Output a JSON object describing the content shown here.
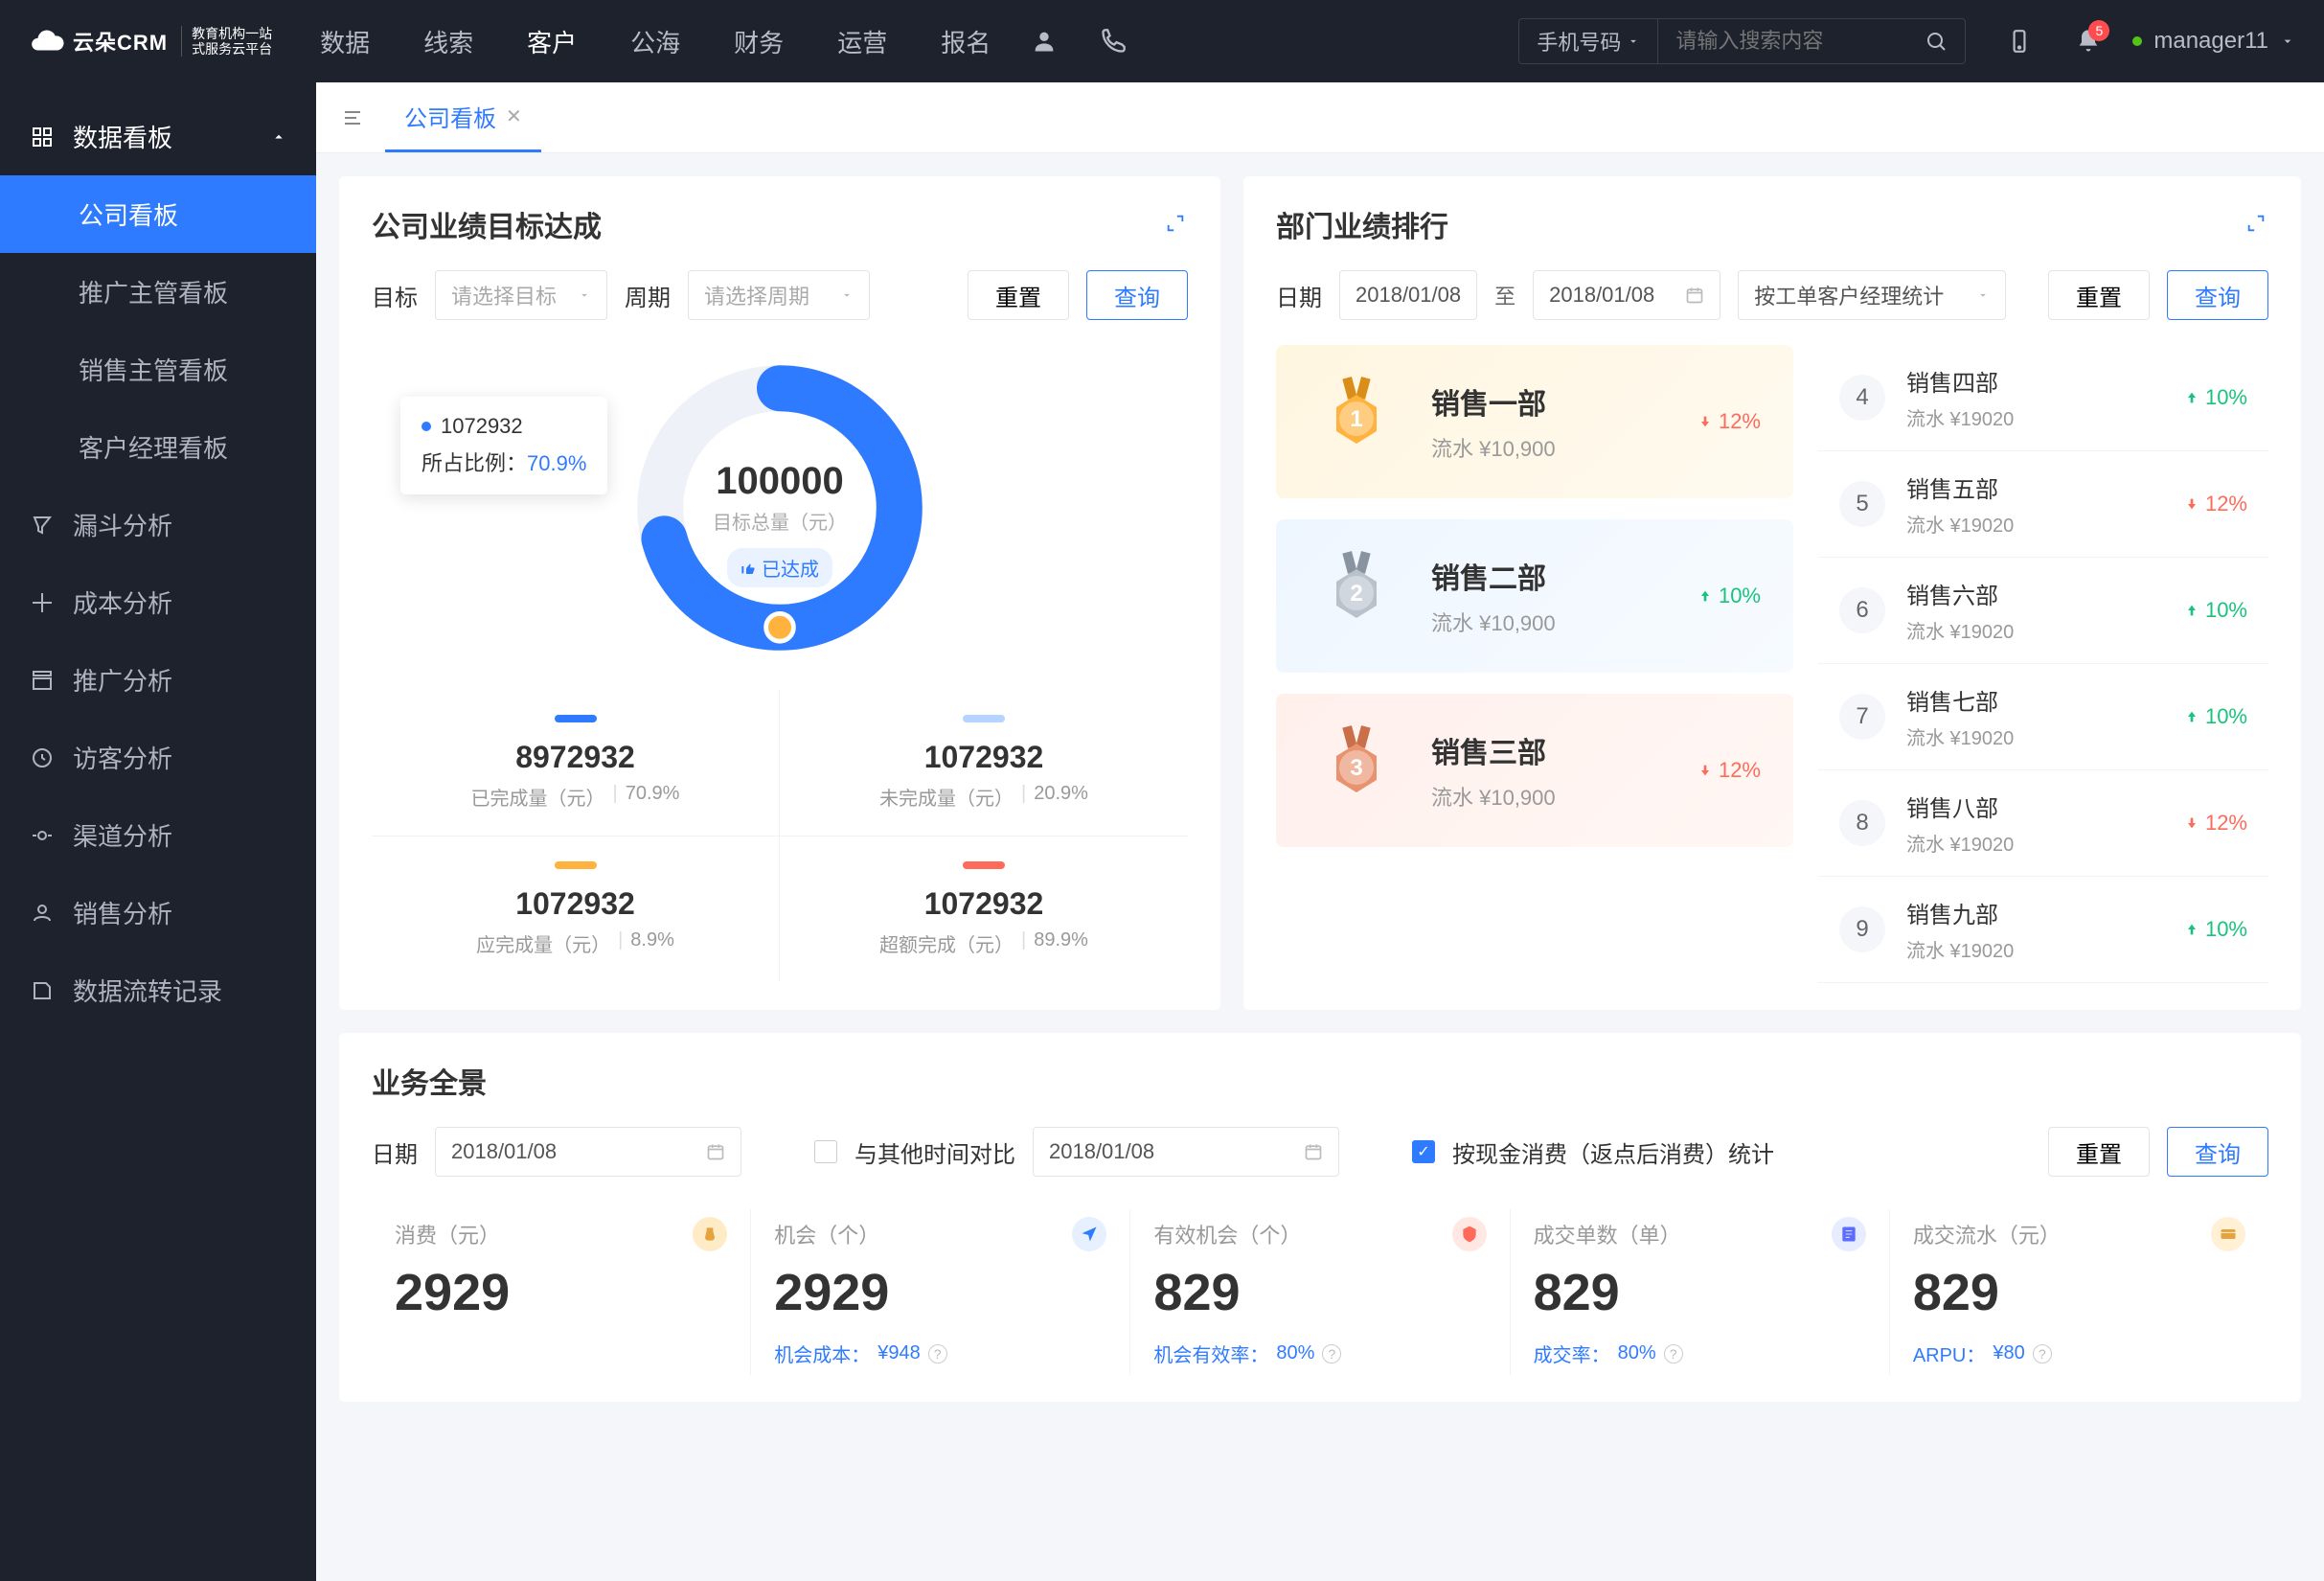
{
  "brand": {
    "name": "云朵CRM",
    "sub1": "教育机构一站",
    "sub2": "式服务云平台"
  },
  "topnav": {
    "items": [
      "数据",
      "线索",
      "客户",
      "公海",
      "财务",
      "运营",
      "报名"
    ],
    "active": 2
  },
  "search": {
    "type": "手机号码",
    "placeholder": "请输入搜索内容"
  },
  "notif_count": "5",
  "user": "manager11",
  "sidebar": {
    "group": "数据看板",
    "subs": [
      "公司看板",
      "推广主管看板",
      "销售主管看板",
      "客户经理看板"
    ],
    "active_sub": 0,
    "items": [
      "漏斗分析",
      "成本分析",
      "推广分析",
      "访客分析",
      "渠道分析",
      "销售分析",
      "数据流转记录"
    ]
  },
  "tab": {
    "label": "公司看板"
  },
  "goals": {
    "title": "公司业绩目标达成",
    "filters": {
      "target_label": "目标",
      "target_ph": "请选择目标",
      "period_label": "周期",
      "period_ph": "请选择周期",
      "reset": "重置",
      "query": "查询"
    },
    "donut": {
      "total": "100000",
      "total_label": "目标总量（元）",
      "badge": "已达成"
    },
    "tooltip": {
      "value": "1072932",
      "ratio_label": "所占比例：",
      "ratio": "70.9%"
    },
    "metrics": [
      {
        "color": "#2f7bff",
        "val": "8972932",
        "label": "已完成量（元）",
        "pct": "70.9%"
      },
      {
        "color": "#b5d4ff",
        "val": "1072932",
        "label": "未完成量（元）",
        "pct": "20.9%"
      },
      {
        "color": "#ffb23e",
        "val": "1072932",
        "label": "应完成量（元）",
        "pct": "8.9%"
      },
      {
        "color": "#ff6a5b",
        "val": "1072932",
        "label": "超额完成（元）",
        "pct": "89.9%"
      }
    ]
  },
  "ranking": {
    "title": "部门业绩排行",
    "filters": {
      "date_label": "日期",
      "date_from": "2018/01/08",
      "sep": "至",
      "date_to": "2018/01/08",
      "stat_by": "按工单客户经理统计",
      "reset": "重置",
      "query": "查询"
    },
    "top": [
      {
        "rank": "1",
        "name": "销售一部",
        "sub": "流水 ¥10,900",
        "trend": "down",
        "pct": "12%"
      },
      {
        "rank": "2",
        "name": "销售二部",
        "sub": "流水 ¥10,900",
        "trend": "up",
        "pct": "10%"
      },
      {
        "rank": "3",
        "name": "销售三部",
        "sub": "流水 ¥10,900",
        "trend": "down",
        "pct": "12%"
      }
    ],
    "rest": [
      {
        "rank": "4",
        "name": "销售四部",
        "sub": "流水 ¥19020",
        "trend": "up",
        "pct": "10%"
      },
      {
        "rank": "5",
        "name": "销售五部",
        "sub": "流水 ¥19020",
        "trend": "down",
        "pct": "12%"
      },
      {
        "rank": "6",
        "name": "销售六部",
        "sub": "流水 ¥19020",
        "trend": "up",
        "pct": "10%"
      },
      {
        "rank": "7",
        "name": "销售七部",
        "sub": "流水 ¥19020",
        "trend": "up",
        "pct": "10%"
      },
      {
        "rank": "8",
        "name": "销售八部",
        "sub": "流水 ¥19020",
        "trend": "down",
        "pct": "12%"
      },
      {
        "rank": "9",
        "name": "销售九部",
        "sub": "流水 ¥19020",
        "trend": "up",
        "pct": "10%"
      }
    ]
  },
  "overview": {
    "title": "业务全景",
    "filters": {
      "date_label": "日期",
      "date": "2018/01/08",
      "compare_label": "与其他时间对比",
      "date2": "2018/01/08",
      "stat_label": "按现金消费（返点后消费）统计",
      "reset": "重置",
      "query": "查询"
    },
    "items": [
      {
        "label": "消费（元）",
        "val": "2929",
        "icon_bg": "#ffecc7",
        "icon_color": "#e6a23c",
        "sub_label": "",
        "sub_val": ""
      },
      {
        "label": "机会（个）",
        "val": "2929",
        "icon_bg": "#e6f0ff",
        "icon_color": "#2f7bff",
        "sub_label": "机会成本：",
        "sub_val": "¥948"
      },
      {
        "label": "有效机会（个）",
        "val": "829",
        "icon_bg": "#ffe8e4",
        "icon_color": "#ff6a5b",
        "sub_label": "机会有效率：",
        "sub_val": "80%"
      },
      {
        "label": "成交单数（单）",
        "val": "829",
        "icon_bg": "#e8ecff",
        "icon_color": "#5b6cff",
        "sub_label": "成交率：",
        "sub_val": "80%"
      },
      {
        "label": "成交流水（元）",
        "val": "829",
        "icon_bg": "#fff0d6",
        "icon_color": "#e6a23c",
        "sub_label": "ARPU：",
        "sub_val": "¥80"
      }
    ]
  },
  "chart_data": {
    "type": "pie",
    "title": "公司业绩目标达成",
    "total": 100000,
    "series": [
      {
        "name": "已完成量（元）",
        "value": 8972932,
        "pct": 70.9,
        "color": "#2f7bff"
      },
      {
        "name": "未完成量（元）",
        "value": 1072932,
        "pct": 20.9,
        "color": "#b5d4ff"
      },
      {
        "name": "应完成量（元）",
        "value": 1072932,
        "pct": 8.9,
        "color": "#ffb23e"
      },
      {
        "name": "超额完成（元）",
        "value": 1072932,
        "pct": 89.9,
        "color": "#ff6a5b"
      }
    ],
    "tooltip": {
      "value": 1072932,
      "ratio": 70.9
    }
  }
}
